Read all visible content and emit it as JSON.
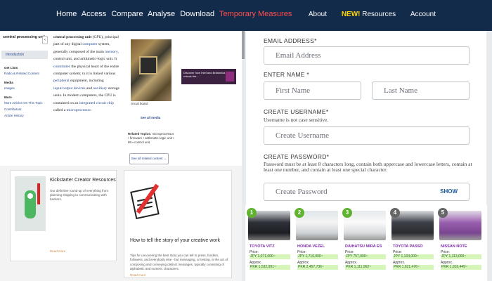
{
  "nav": {
    "left": [
      "Home",
      "Access",
      "Compare",
      "Analyse",
      "Download"
    ],
    "left_highlight": "Temporary Measures",
    "right_about": "About",
    "right_new": "NEW!",
    "right_resources": "Resources",
    "right_account": "Account"
  },
  "wiki": {
    "side_title": "central processing unit",
    "collapse": "‹",
    "selected": "Introduction",
    "group1": "Get Lists",
    "group1_link": "Radio & Related Content",
    "group2": "Media",
    "group2_link": "Images",
    "group3": "More",
    "more_links": [
      "More Articles On This Topic",
      "Contributors",
      "Article History"
    ],
    "body_bold": "central processing unit",
    "body_abbr": " (CPU),",
    "body_t1": " principal part of any digital ",
    "link_computer": "computer",
    "body_t2": " system, generally composed of the main ",
    "link_memory": "memory",
    "body_t3": ", control unit, and arithmetic-logic unit. It ",
    "link_constitutes": "constitutes",
    "body_t4": " the physical heart of the entire computer system; to it is linked various ",
    "link_peripheral": "peripheral",
    "body_t5": " equipment, including ",
    "link_io": "input/output devices",
    "body_t6": " and ",
    "link_aux": "auxiliary",
    "body_t7": " storage units. In modern computers, the CPU is contained on an ",
    "link_chip": "integrated circuit chip",
    "body_t8": " called a ",
    "link_micro": "microprocessor",
    "body_t9": ".",
    "media_caption": "circuit board",
    "media_seeall": "See all media",
    "related_label": "Related Topics:",
    "related_text": "microprocessor • firmware • arithmetic-logic unit • MI • control unit",
    "related_button": "See all related content →",
    "ad_text": "Discover how Intel and Britannica help unlock the..."
  },
  "cards": {
    "kick_title": "Kickstarter Creator Resources",
    "kick_desc": "Our definitive round-up of everything from planning shipping to communicating with backers.",
    "kick_more": "Read more",
    "story_title": "How to tell the story of your creative work",
    "story_desc": "Tips for uncovering the best story you can tell to press, funders, followers, and everybody else - but messaging, or testing, is the act of composing and conveying distinct messages, typically consisting of alphabetic and numeric characters.",
    "story_more": "Read more"
  },
  "form": {
    "email_label": "EMAIL ADDRESS*",
    "email_placeholder": "Email Address",
    "name_label": "ENTER NAME *",
    "first_placeholder": "First Name",
    "last_placeholder": "Last Name",
    "username_label": "CREATE USERNAME*",
    "username_hint": "Username is not case sensitive.",
    "username_placeholder": "Create Username",
    "password_label": "CREATE PASSWORD*",
    "password_hint": "Password must be at least 8 characters long, contain both uppercase and lowercase letters, contain at least one number, and contain at least one special character.",
    "password_placeholder": "Create Password",
    "show": "SHOW"
  },
  "cars": [
    {
      "rank": "1",
      "name": "TOYOTA VITZ",
      "price_label": "Price:",
      "jpy": "JPY 1,071,000~",
      "approx": "Approx.",
      "usd": "PKR 1,532,991~",
      "badge_color": "#5fb32f",
      "color": "#2d3037"
    },
    {
      "rank": "2",
      "name": "HONDA VEZEL",
      "price_label": "Price:",
      "jpy": "JPY 1,716,000~",
      "approx": "Approx.",
      "usd": "PKR 2,457,736~",
      "badge_color": "#5fb32f",
      "color": "#f2f2f2"
    },
    {
      "rank": "3",
      "name": "DAIHATSU MIRA ES",
      "price_label": "Price:",
      "jpy": "JPY 757,000~",
      "approx": "Approx.",
      "usd": "PKR 1,111,962~",
      "badge_color": "#5fb32f",
      "color": "#f7f7f7"
    },
    {
      "rank": "4",
      "name": "TOYOTA PASSO",
      "price_label": "Price:",
      "jpy": "JPY 1,134,000~",
      "approx": "Approx.",
      "usd": "PKR 1,621,476~",
      "badge_color": "#666666",
      "color": "#3c3f46"
    },
    {
      "rank": "5",
      "name": "NISSAN NOTE",
      "price_label": "Price:",
      "jpy": "JPY 1,113,000~",
      "approx": "Approx.",
      "usd": "PKR 1,916,449~",
      "badge_color": "#666666",
      "color": "#9a5fb0"
    }
  ]
}
